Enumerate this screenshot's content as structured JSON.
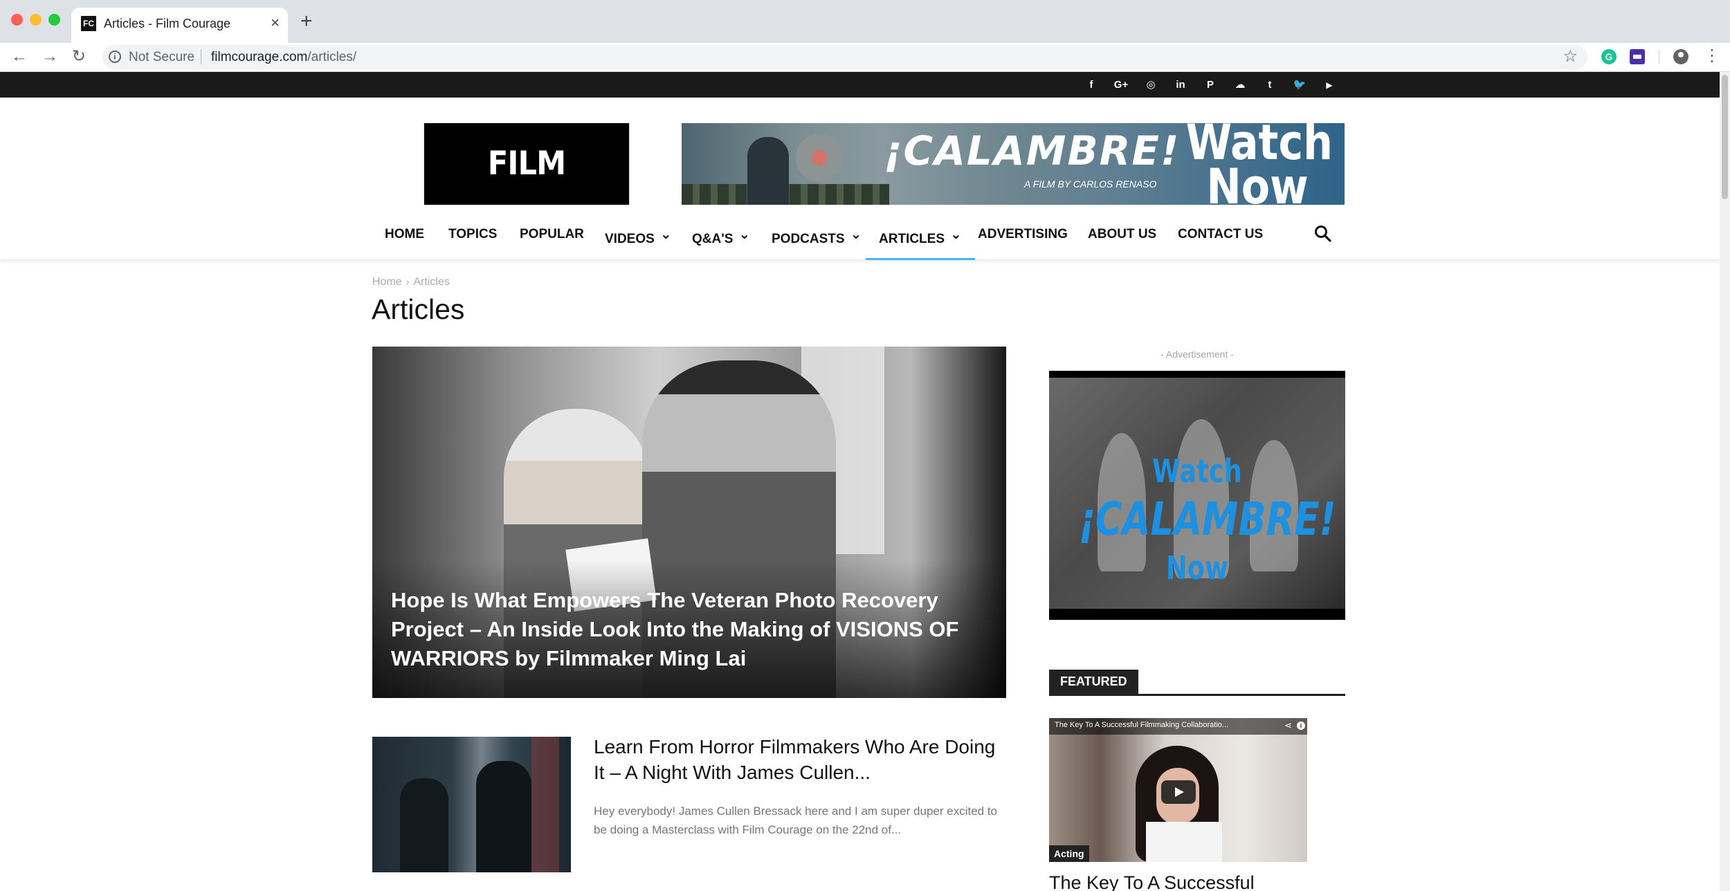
{
  "browser": {
    "tab_title": "Articles - Film Courage",
    "tab_favicon": "FC",
    "security_label": "Not Secure",
    "url_domain": "filmcourage.com",
    "url_path": "/articles/"
  },
  "social_icons": [
    {
      "name": "facebook-icon",
      "glyph": "f"
    },
    {
      "name": "google-plus-icon",
      "glyph": "G+"
    },
    {
      "name": "instagram-icon",
      "glyph": "◎"
    },
    {
      "name": "linkedin-icon",
      "glyph": "in"
    },
    {
      "name": "pinterest-icon",
      "glyph": "P"
    },
    {
      "name": "soundcloud-icon",
      "glyph": "☁"
    },
    {
      "name": "tumblr-icon",
      "glyph": "t"
    },
    {
      "name": "twitter-icon",
      "glyph": "🐦"
    },
    {
      "name": "youtube-icon",
      "glyph": "▶"
    }
  ],
  "header": {
    "logo_text": "FILM COURAGE",
    "banner": {
      "title": "¡CALAMBRE!",
      "subtitle": "A FILM BY CARLOS RENASO",
      "cta": "Watch Now"
    }
  },
  "nav": {
    "items": [
      {
        "label": "HOME",
        "dropdown": false
      },
      {
        "label": "TOPICS",
        "dropdown": false
      },
      {
        "label": "POPULAR",
        "dropdown": false
      },
      {
        "label": "VIDEOS",
        "dropdown": true
      },
      {
        "label": "Q&A'S",
        "dropdown": true
      },
      {
        "label": "PODCASTS",
        "dropdown": true
      },
      {
        "label": "ARTICLES",
        "dropdown": true,
        "active": true
      },
      {
        "label": "ADVERTISING",
        "dropdown": false
      },
      {
        "label": "ABOUT US",
        "dropdown": false
      },
      {
        "label": "CONTACT US",
        "dropdown": false
      }
    ],
    "accent_color": "#4db2ec"
  },
  "page": {
    "breadcrumb": [
      "Home",
      "Articles"
    ],
    "title": "Articles"
  },
  "hero": {
    "title": "Hope Is What Empowers The Veteran Photo Recovery Project – An Inside Look Into the Making of VISIONS OF WARRIORS by Filmmaker Ming Lai"
  },
  "posts": [
    {
      "title": "Learn From Horror Filmmakers Who Are Doing It – A Night With James Cullen...",
      "excerpt": "Hey everybody! James Cullen Bressack here and I am super duper excited to be doing a Masterclass with Film Courage on the 22nd of..."
    }
  ],
  "sidebar": {
    "ad_label": "- Advertisement -",
    "ad_text": [
      "Watch",
      "¡CALAMBRE!",
      "Now"
    ],
    "featured_label": "FEATURED",
    "featured_video_title": "The Key To A Successful Filmmaking Collaboratio...",
    "featured_category": "Acting",
    "featured_title": "The Key To A Successful"
  }
}
